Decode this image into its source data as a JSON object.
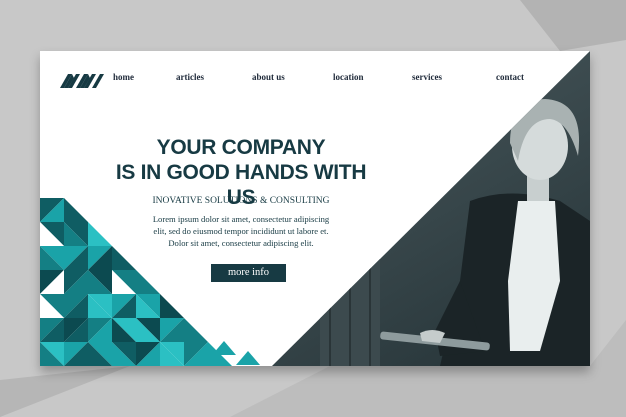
{
  "brand": {
    "logo": "triangles-logo-icon"
  },
  "nav": {
    "items": [
      {
        "label": "home"
      },
      {
        "label": "articles"
      },
      {
        "label": "about us"
      },
      {
        "label": "location"
      },
      {
        "label": "services"
      },
      {
        "label": "contact"
      }
    ]
  },
  "hero": {
    "title_line1": "YOUR COMPANY",
    "title_line2": "IS IN GOOD HANDS WITH US",
    "subtitle": "INOVATIVE SOLUTIONS & CONSULTING",
    "body_line1": "Lorem ipsum dolor sit amet, consectetur adipiscing",
    "body_line2": "elit, sed do eiusmod tempor incididunt ut labore et.",
    "body_line3": "Dolor sit amet, consectetur adipiscing elit.",
    "cta_label": "more info"
  },
  "colors": {
    "primary": "#173a43",
    "accent_teal": "#1aa3a8",
    "background": "#c8c8c8",
    "card": "#ffffff"
  }
}
